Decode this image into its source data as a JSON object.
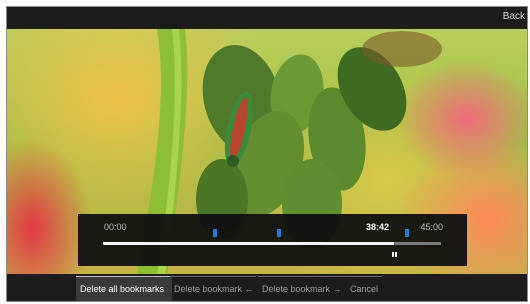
{
  "header": {
    "back_label": "Back"
  },
  "player": {
    "time_start": "00:00",
    "time_current": "38:42",
    "time_end": "45:00",
    "progress_fraction": 0.86,
    "bookmark_positions": [
      0.33,
      0.52,
      0.9
    ],
    "accent_color": "#1f7ad1"
  },
  "commands": [
    {
      "label": "Delete all bookmarks",
      "active": true
    },
    {
      "label": "Delete bookmark ←",
      "active": false
    },
    {
      "label": "Delete bookmark →",
      "active": false
    },
    {
      "label": "Cancel",
      "active": false
    }
  ]
}
